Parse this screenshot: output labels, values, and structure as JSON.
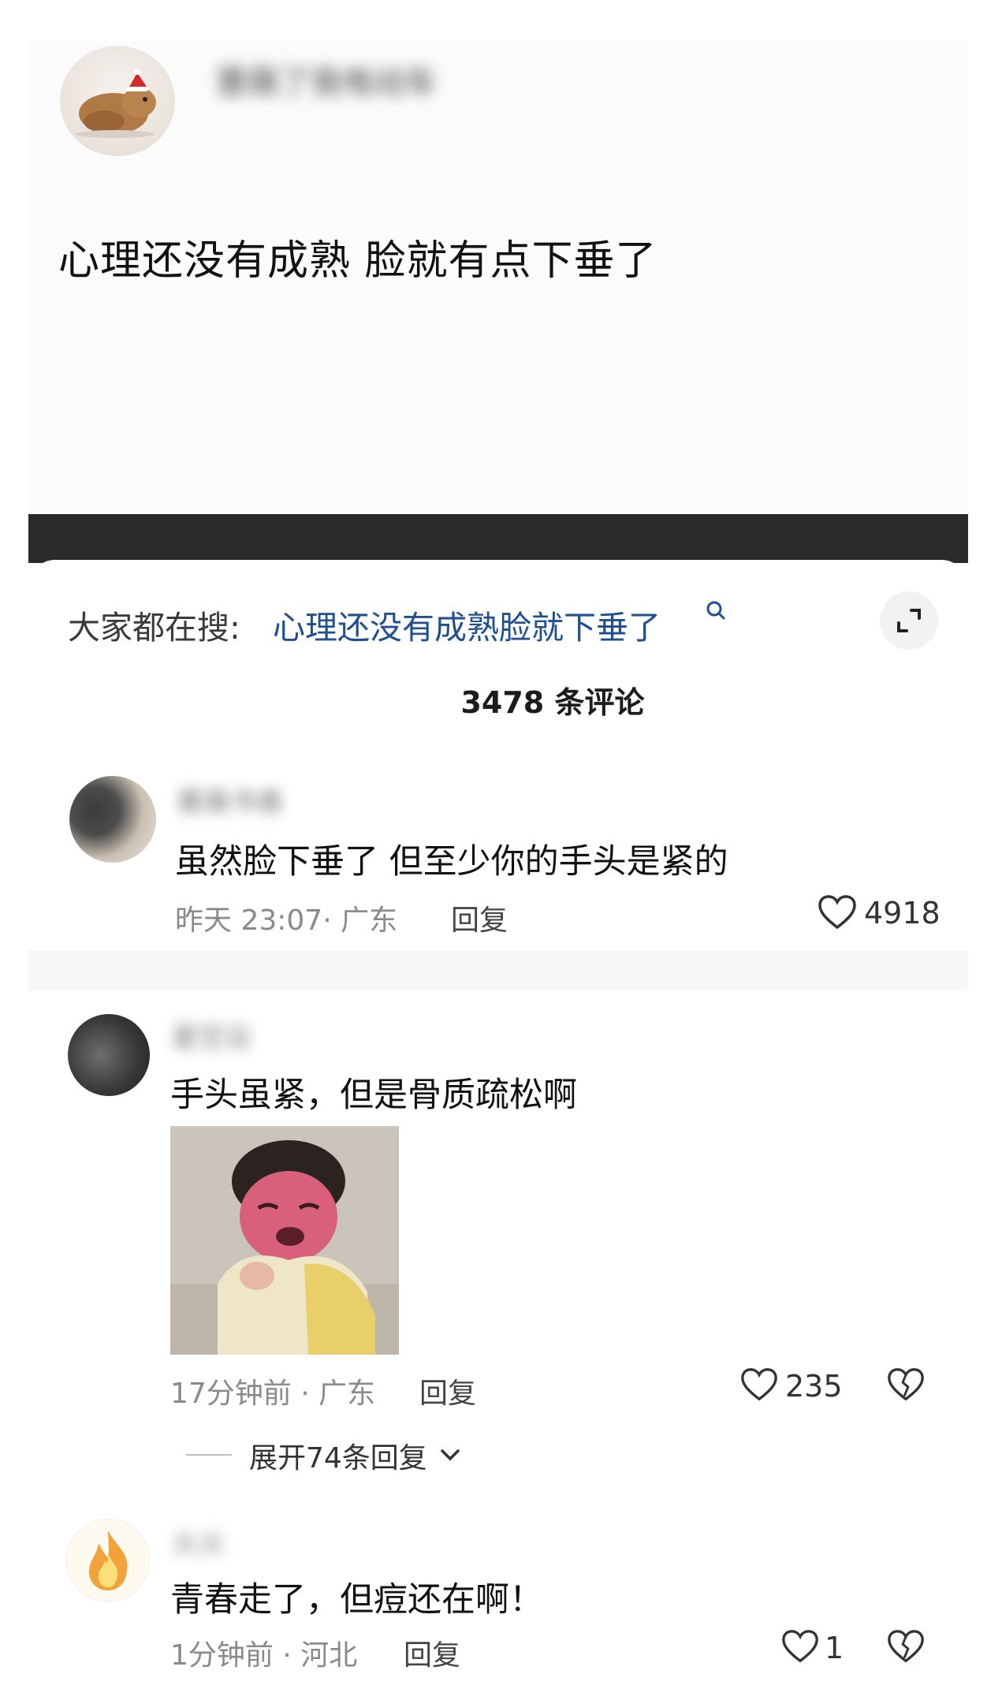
{
  "post": {
    "username": "蔷薇了我电动车",
    "text": "心理还没有成熟 脸就有点下垂了",
    "avatar_icon": "hamster-with-santa-hat-icon"
  },
  "comments_panel": {
    "search_prefix": "大家都在搜:",
    "search_term": "心理还没有成熟脸就下垂了",
    "search_icon": "search-icon",
    "expand_icon": "expand-icon",
    "comment_count": "3478",
    "comment_count_suffix": "条评论"
  },
  "comments": [
    {
      "username": "蔷薇书香",
      "text": "虽然脸下垂了 但至少你的手头是紧的",
      "time_location": "昨天 23:07· 广东",
      "reply_label": "回复",
      "likes": "4918"
    },
    {
      "username": "星空云",
      "text": "手头虽紧，但是骨质疏松啊",
      "image_icon": "crying-child-sticker",
      "time_location": "17分钟前 · 广东",
      "reply_label": "回复",
      "likes": "235",
      "expand_replies": "展开74条回复"
    },
    {
      "username": "火火",
      "text": "青春走了，但痘还在啊！",
      "time_location": "1分钟前 · 河北",
      "reply_label": "回复",
      "likes": "1"
    }
  ],
  "colors": {
    "link": "#1f4f8f",
    "meta": "#8a8a8a",
    "dark_band": "#2a2a2a"
  }
}
